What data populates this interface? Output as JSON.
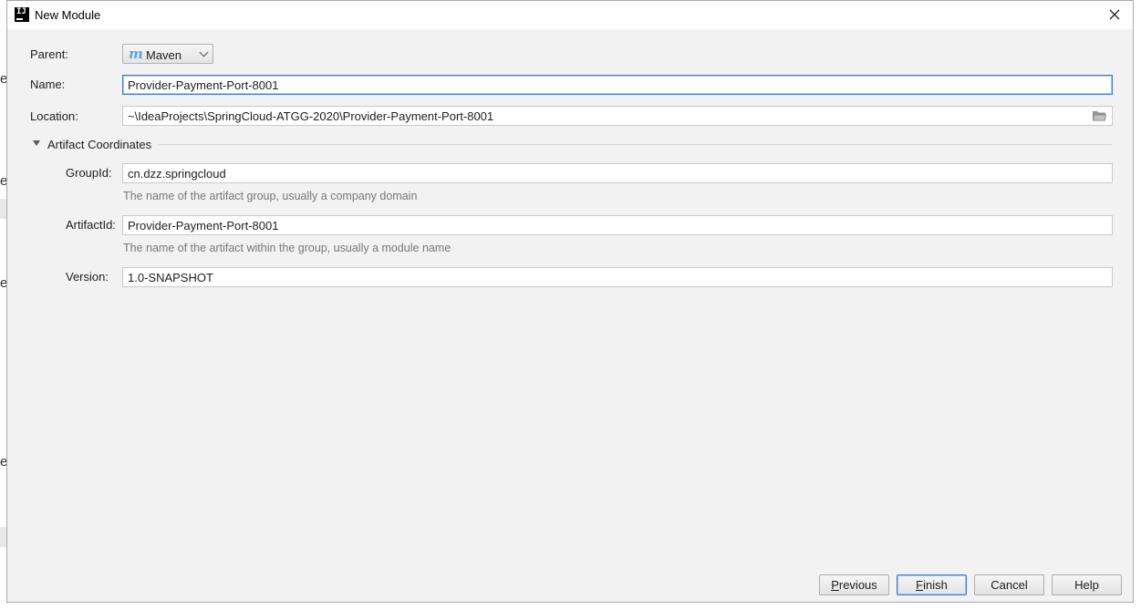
{
  "window": {
    "title": "New Module"
  },
  "form": {
    "parent": {
      "label": "Parent:",
      "value": "Maven"
    },
    "name": {
      "label": "Name:",
      "value": "Provider-Payment-Port-8001"
    },
    "location": {
      "label": "Location:",
      "value": "~\\IdeaProjects\\SpringCloud-ATGG-2020\\Provider-Payment-Port-8001"
    }
  },
  "artifact": {
    "section_title": "Artifact Coordinates",
    "group_id": {
      "label": "GroupId:",
      "value": "cn.dzz.springcloud",
      "hint": "The name of the artifact group, usually a company domain"
    },
    "artifact_id": {
      "label": "ArtifactId:",
      "value": "Provider-Payment-Port-8001",
      "hint": "The name of the artifact within the group, usually a module name"
    },
    "version": {
      "label": "Version:",
      "value": "1.0-SNAPSHOT"
    }
  },
  "buttons": {
    "previous": {
      "mnemonic": "P",
      "rest": "revious"
    },
    "finish": {
      "mnemonic": "F",
      "rest": "inish"
    },
    "cancel": "Cancel",
    "help": "Help"
  },
  "icons": {
    "app": "intellij-idea-icon",
    "parent": "maven-icon",
    "location_browse": "folder-icon",
    "section": "triangle-down-icon",
    "close": "close-icon"
  },
  "colors": {
    "accent": "#3d7fcf",
    "maven": "#5aa3d8",
    "hint": "#787878",
    "dialog_bg": "#f2f2f2"
  }
}
